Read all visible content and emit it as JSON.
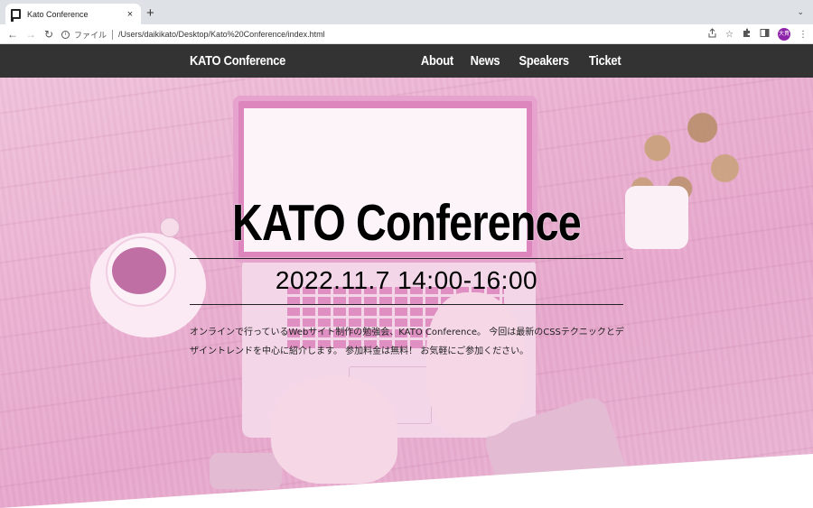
{
  "browser": {
    "tab_title": "Kato Conference",
    "tab_close": "×",
    "new_tab": "+",
    "tab_menu": "⌄",
    "back": "←",
    "forward": "→",
    "reload": "↻",
    "info": "i",
    "scheme_label": "ファイル",
    "url": "/Users/daikikato/Desktop/Kato%20Conference/index.html",
    "profile_initials": "大貴",
    "icons": [
      "share-icon",
      "star-icon",
      "extensions-icon",
      "side-panel-icon",
      "profile-avatar",
      "kebab-menu-icon"
    ]
  },
  "site": {
    "logo": "KATO Conference",
    "nav": [
      "About",
      "News",
      "Speakers",
      "Ticket"
    ],
    "header_bg": "#333333"
  },
  "hero": {
    "title": "KATO Conference",
    "date": "2022.11.7 14:00-16:00",
    "description": "オンラインで行っているWebサイト制作の勉強会、KATO Conference。 今回は最新のCSSテクニックとデザイントレンドを中心に紹介します。 参加料金は無料！ お気軽にご参加ください。",
    "overlay_color": "#e8a8cf"
  }
}
